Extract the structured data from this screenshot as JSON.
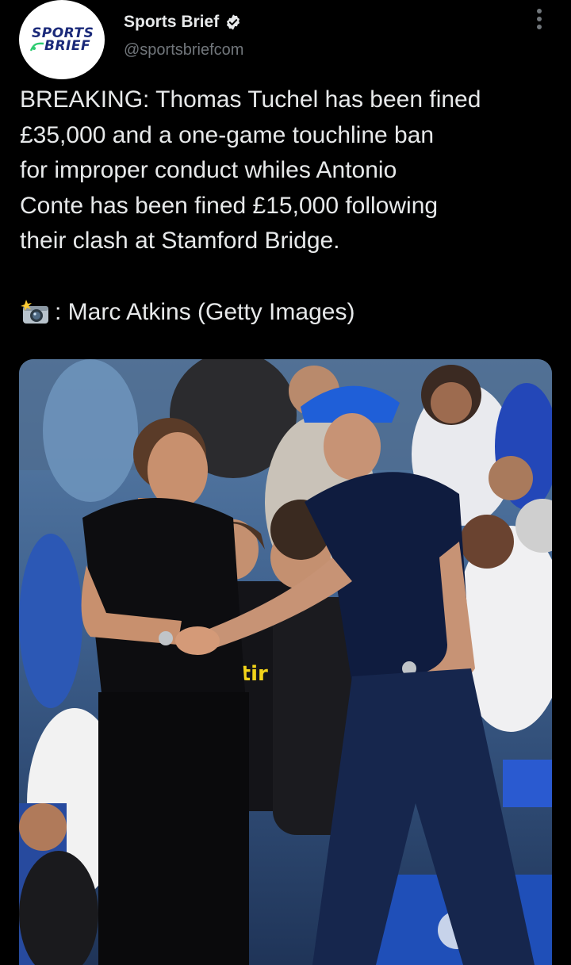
{
  "account": {
    "display_name": "Sports Brief",
    "handle": "@sportsbriefcom",
    "verified": true,
    "logo_line1": "SPORTS",
    "logo_line2": "BRIEF"
  },
  "tweet": {
    "text": "BREAKING: Thomas Tuchel has been fined\n£35,000 and a one-game touchline ban\nfor improper conduct whiles Antonio\nConte has been fined £15,000 following\ntheir clash at Stamford Bridge.",
    "credit": ": Marc Atkins (Getty Images)",
    "credit_icon": "camera-flash-icon"
  },
  "icons": {
    "menu": "more-vertical-icon",
    "verified": "verified-badge-icon"
  },
  "colors": {
    "background": "#000000",
    "text": "#e7e9ea",
    "secondary": "#71767b",
    "accent_blue": "#1d4fd6"
  }
}
